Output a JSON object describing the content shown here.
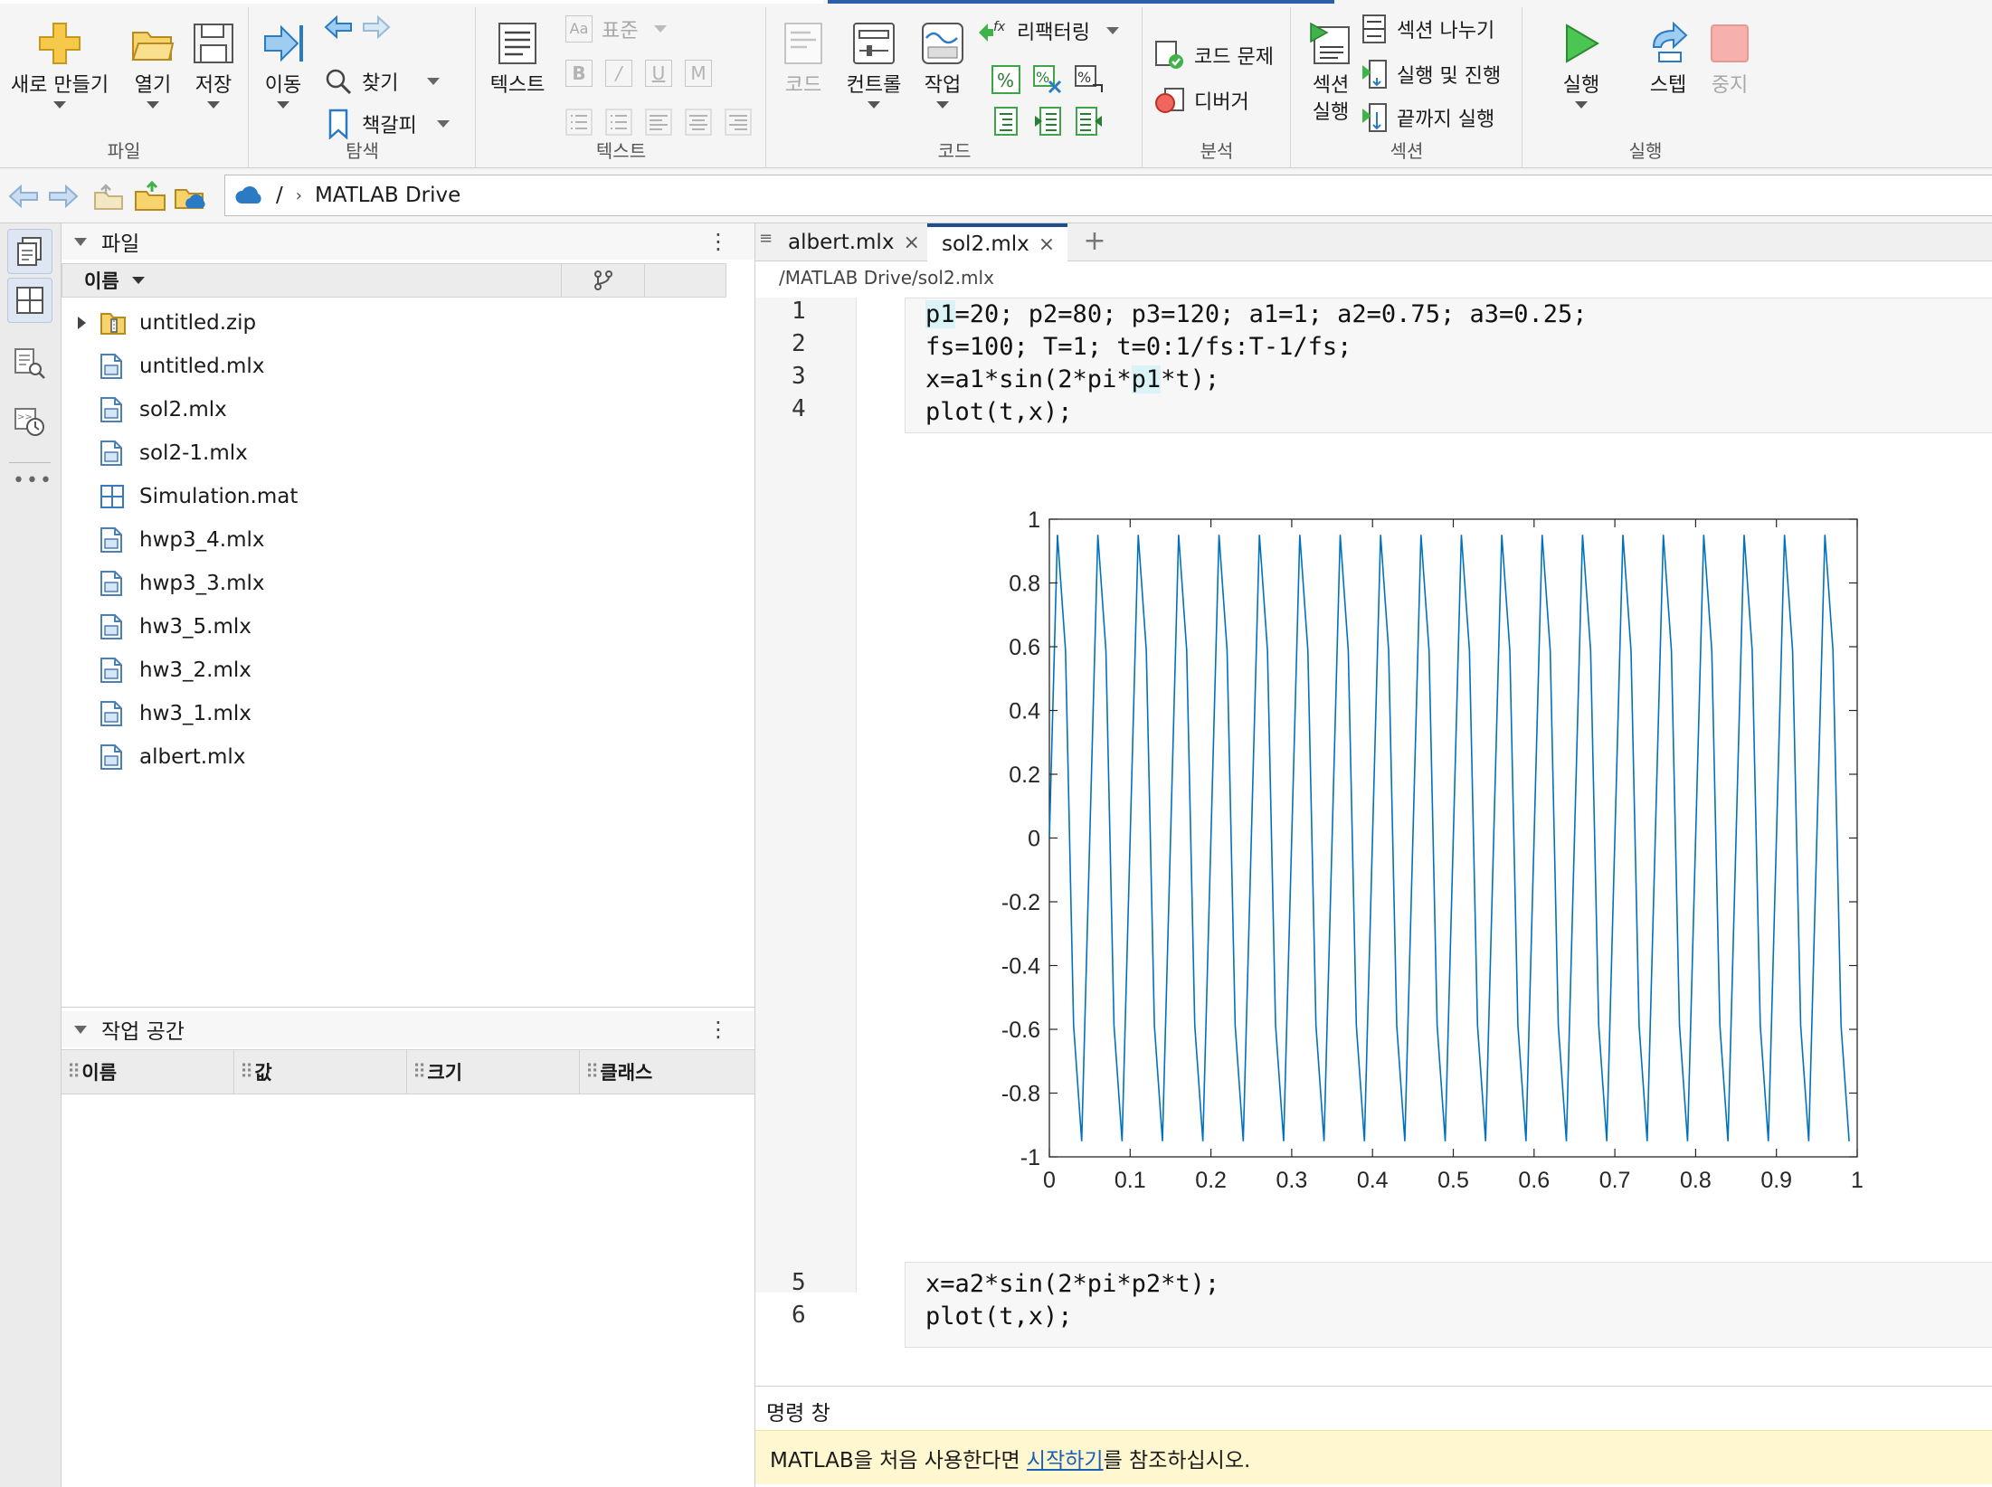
{
  "ribbon": {
    "groups": {
      "file": "파일",
      "navigate": "탐색",
      "text": "텍스트",
      "code": "코드",
      "analyze": "분석",
      "section": "섹션",
      "run": "실행"
    },
    "new_label": "새로 만들기",
    "open_label": "열기",
    "save_label": "저장",
    "goto_label": "이동",
    "find_label": "찾기",
    "bookmark_label": "책갈피",
    "text_label": "텍스트",
    "style_normal": "표준",
    "code_label": "코드",
    "control_label": "컨트롤",
    "task_label": "작업",
    "refactor_label": "리팩터링",
    "code_issues_label": "코드 문제",
    "debugger_label": "디버거",
    "section_run_line1": "섹션",
    "section_run_line2": "실행",
    "section_break_label": "섹션 나누기",
    "run_advance_label": "실행 및 진행",
    "run_to_end_label": "끝까지 실행",
    "run_label": "실행",
    "step_label": "스텝",
    "stop_label": "중지"
  },
  "address": {
    "root": "/",
    "folder": "MATLAB Drive"
  },
  "files_panel": {
    "title": "파일",
    "col_name": "이름",
    "items": [
      {
        "name": "untitled.zip",
        "type": "zip"
      },
      {
        "name": "untitled.mlx",
        "type": "mlx"
      },
      {
        "name": "sol2.mlx",
        "type": "mlx"
      },
      {
        "name": "sol2-1.mlx",
        "type": "mlx"
      },
      {
        "name": "Simulation.mat",
        "type": "mat"
      },
      {
        "name": "hwp3_4.mlx",
        "type": "mlx"
      },
      {
        "name": "hwp3_3.mlx",
        "type": "mlx"
      },
      {
        "name": "hw3_5.mlx",
        "type": "mlx"
      },
      {
        "name": "hw3_2.mlx",
        "type": "mlx"
      },
      {
        "name": "hw3_1.mlx",
        "type": "mlx"
      },
      {
        "name": "albert.mlx",
        "type": "mlx"
      }
    ]
  },
  "workspace_panel": {
    "title": "작업 공간",
    "columns": [
      "이름",
      "값",
      "크기",
      "클래스"
    ]
  },
  "editor": {
    "tabs": [
      {
        "label": "albert.mlx",
        "active": false
      },
      {
        "label": "sol2.mlx",
        "active": true
      }
    ],
    "add_tab": "+",
    "path": "/MATLAB Drive/sol2.mlx",
    "lines": [
      {
        "n": "1",
        "code": "p1=20; p2=80; p3=120; a1=1; a2=0.75; a3=0.25;"
      },
      {
        "n": "2",
        "code": "fs=100; T=1; t=0:1/fs:T-1/fs;"
      },
      {
        "n": "3",
        "code": "x=a1*sin(2*pi*p1*t);"
      },
      {
        "n": "4",
        "code": "plot(t,x);"
      },
      {
        "n": "5",
        "code": "x=a2*sin(2*pi*p2*t);"
      },
      {
        "n": "6",
        "code": "plot(t,x);"
      }
    ]
  },
  "chart_data": {
    "type": "line",
    "title": "",
    "xlabel": "",
    "ylabel": "",
    "xlim": [
      0,
      1
    ],
    "ylim": [
      -1,
      1
    ],
    "xticks": [
      "0",
      "0.1",
      "0.2",
      "0.3",
      "0.4",
      "0.5",
      "0.6",
      "0.7",
      "0.8",
      "0.9",
      "1"
    ],
    "yticks": [
      "1",
      "0.8",
      "0.6",
      "0.4",
      "0.2",
      "0",
      "-0.2",
      "-0.4",
      "-0.6",
      "-0.8",
      "-1"
    ],
    "series": [
      {
        "color": "#0072bd",
        "amplitude": 1,
        "frequency": 20,
        "fs": 100,
        "t_start": 0,
        "t_end": 0.99
      }
    ],
    "grid": false,
    "legend": "none"
  },
  "command_window": {
    "title": "명령 창",
    "msg_prefix": "MATLAB을 처음 사용한다면 ",
    "msg_link": "시작하기",
    "msg_suffix": "를 참조하십시오."
  },
  "colors": {
    "accent": "#1f4e8c",
    "plot_line": "#0072bd",
    "run_green": "#2eaa3a",
    "notice_bg": "#fff7cf"
  }
}
